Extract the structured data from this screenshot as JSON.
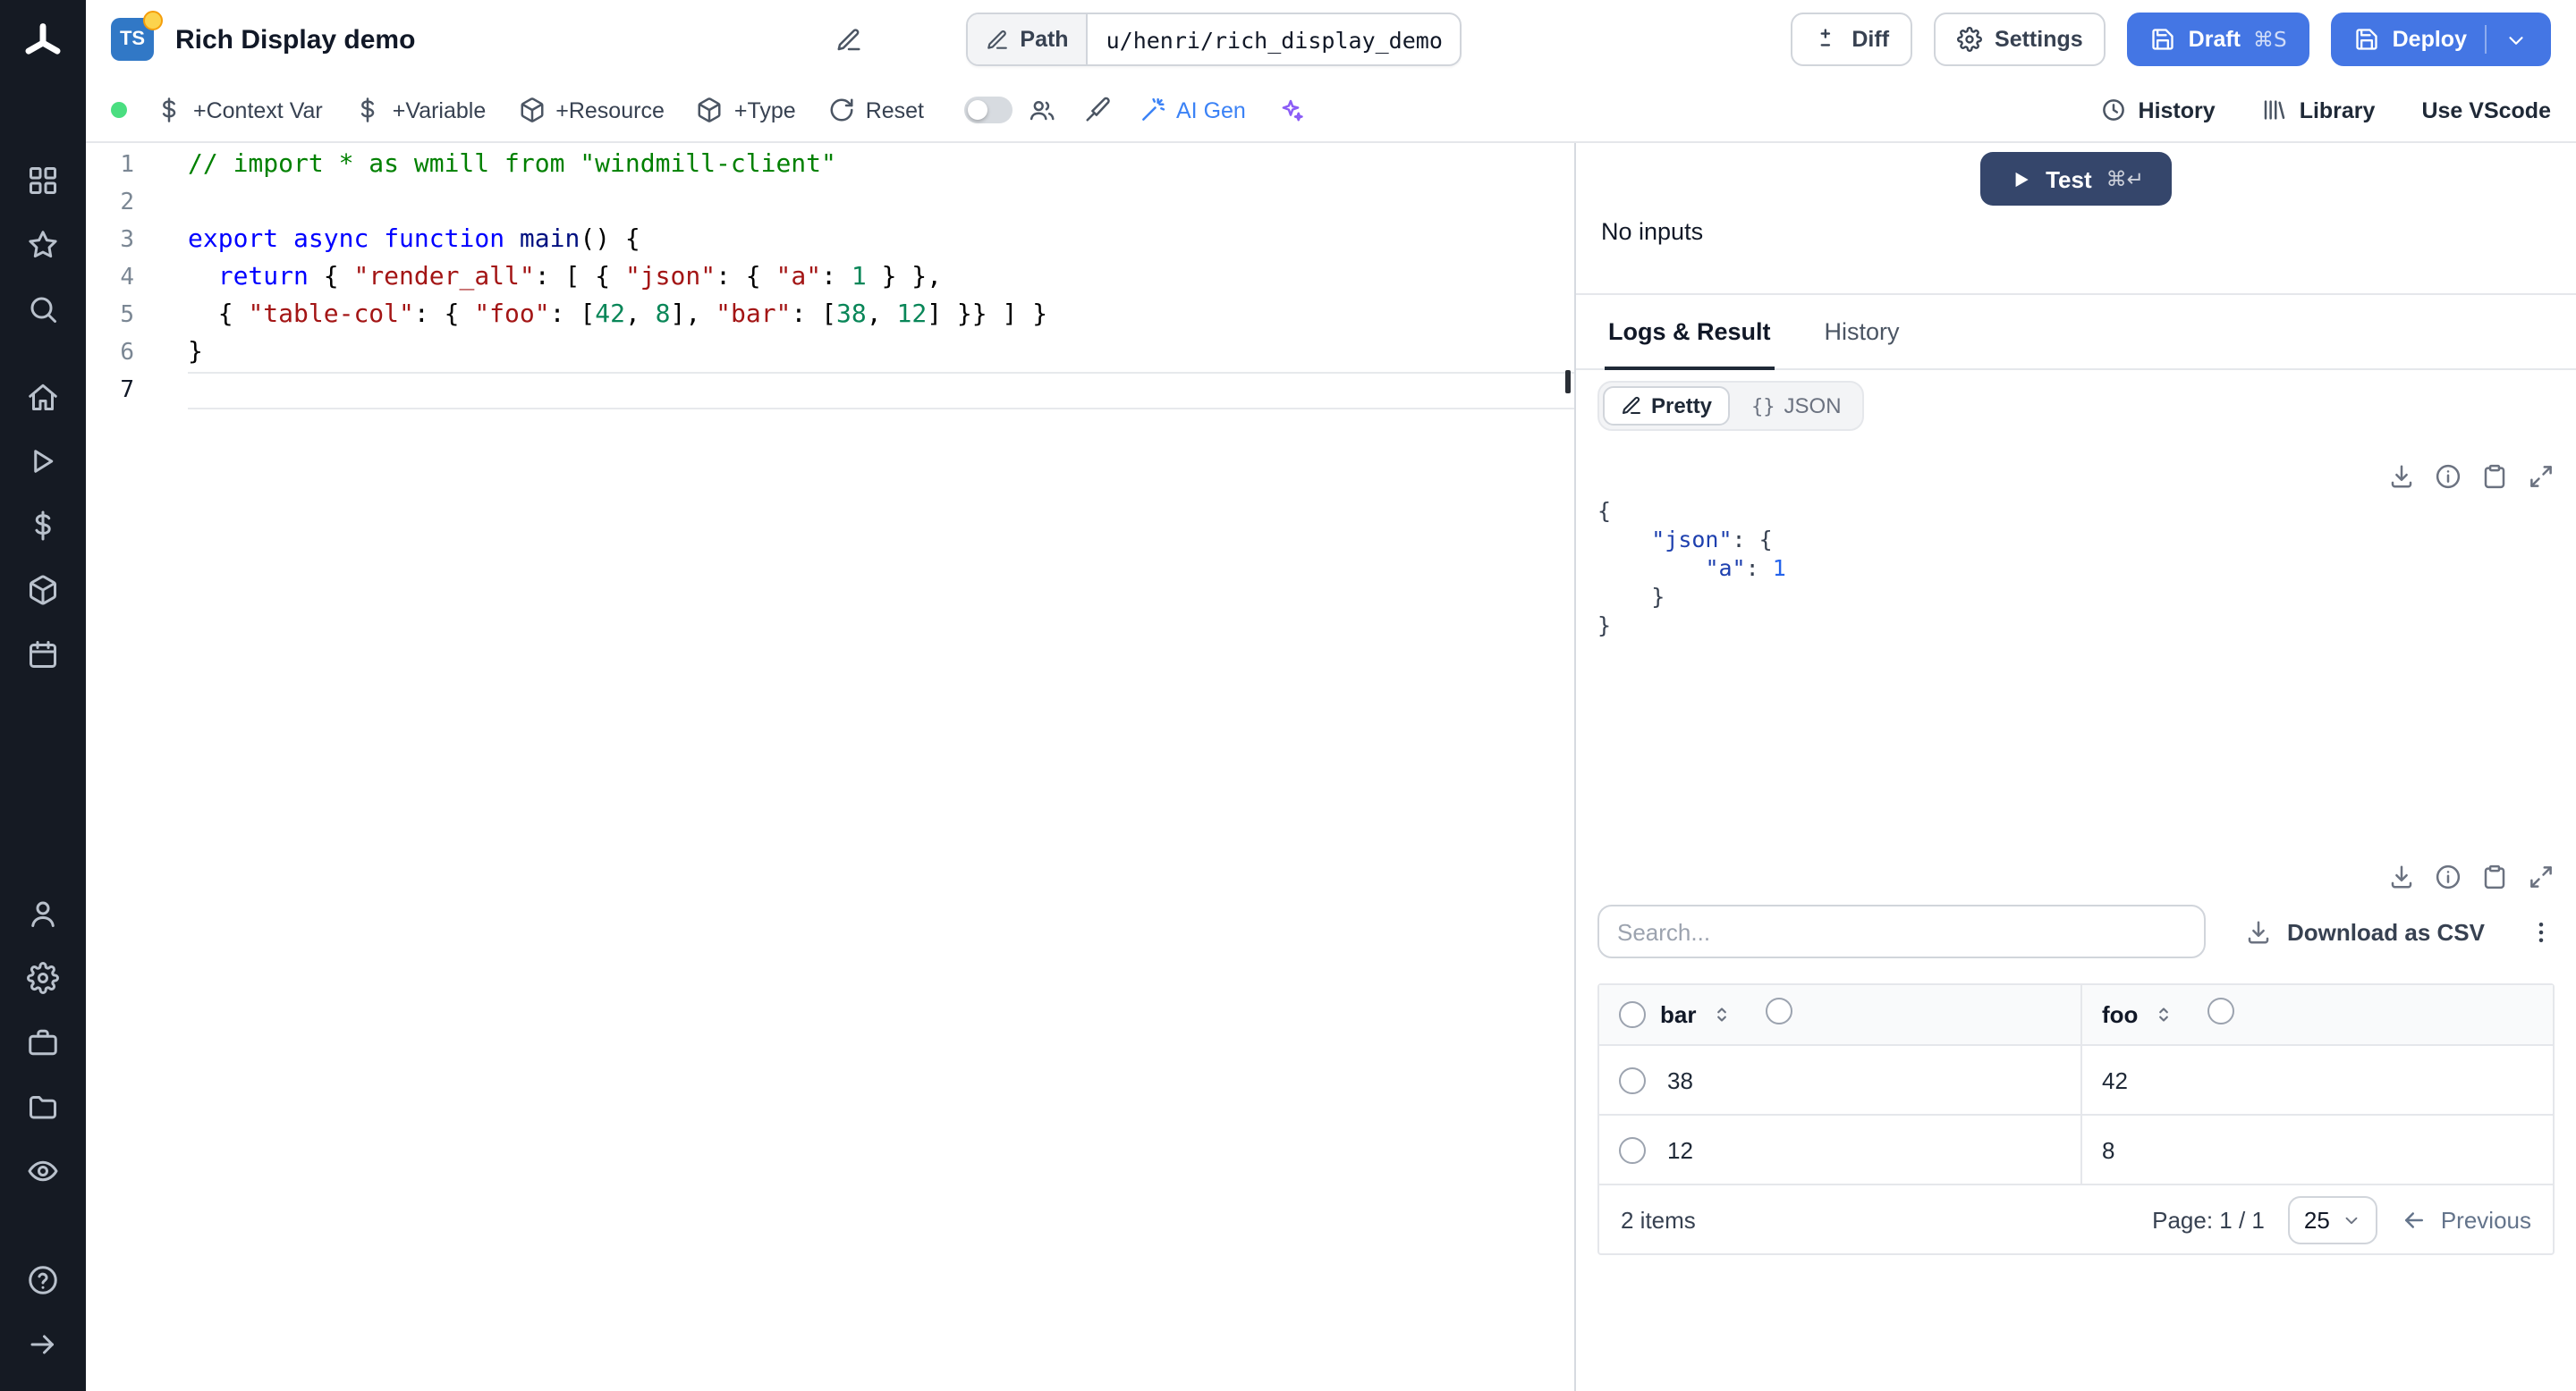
{
  "colors": {
    "primary_blue": "#4476e4",
    "test_dark": "#35466b",
    "ai_blue": "#3b82f6",
    "status_green": "#4ade80"
  },
  "sidebar": {
    "groups": [
      [
        "grid",
        "star",
        "search"
      ],
      [
        "home",
        "play",
        "dollar",
        "package",
        "calendar"
      ],
      [
        "user",
        "settings",
        "briefcase",
        "folder",
        "eye"
      ]
    ],
    "bottom": [
      "help",
      "arrow-right"
    ]
  },
  "header": {
    "language_badge": "TS",
    "title": "Rich Display demo",
    "path_label": "Path",
    "path_value": "u/henri/rich_display_demo",
    "diff_label": "Diff",
    "settings_label": "Settings",
    "draft_label": "Draft",
    "draft_shortcut": "⌘S",
    "deploy_label": "Deploy"
  },
  "toolbar": {
    "items": [
      {
        "icon": "dollar",
        "label": "+Context Var"
      },
      {
        "icon": "dollar",
        "label": "+Variable"
      },
      {
        "icon": "package",
        "label": "+Resource"
      },
      {
        "icon": "package",
        "label": "+Type"
      },
      {
        "icon": "refresh",
        "label": "Reset"
      }
    ],
    "ai_gen_label": "AI Gen",
    "history_label": "History",
    "library_label": "Library",
    "vscode_label": "Use VScode"
  },
  "editor": {
    "lines": [
      {
        "n": 1,
        "tokens": [
          [
            "// import * as wmill from \"windmill-client\"",
            "comment"
          ]
        ]
      },
      {
        "n": 2,
        "tokens": []
      },
      {
        "n": 3,
        "tokens": [
          [
            "export ",
            "kw"
          ],
          [
            "async ",
            "kw"
          ],
          [
            "function ",
            "kw"
          ],
          [
            "main",
            "ident"
          ],
          [
            "() {",
            "plain"
          ]
        ]
      },
      {
        "n": 4,
        "tokens": [
          [
            "  ",
            "plain"
          ],
          [
            "return",
            "kw"
          ],
          [
            " { ",
            "plain"
          ],
          [
            "\"render_all\"",
            "str"
          ],
          [
            ": [ { ",
            "plain"
          ],
          [
            "\"json\"",
            "str"
          ],
          [
            ": { ",
            "plain"
          ],
          [
            "\"a\"",
            "str"
          ],
          [
            ": ",
            "plain"
          ],
          [
            "1",
            "num"
          ],
          [
            " } },",
            "plain"
          ]
        ]
      },
      {
        "n": 5,
        "tokens": [
          [
            "  { ",
            "plain"
          ],
          [
            "\"table-col\"",
            "str"
          ],
          [
            ": { ",
            "plain"
          ],
          [
            "\"foo\"",
            "str"
          ],
          [
            ": [",
            "plain"
          ],
          [
            "42",
            "num"
          ],
          [
            ", ",
            "plain"
          ],
          [
            "8",
            "num"
          ],
          [
            "], ",
            "plain"
          ],
          [
            "\"bar\"",
            "str"
          ],
          [
            ": [",
            "plain"
          ],
          [
            "38",
            "num"
          ],
          [
            ", ",
            "plain"
          ],
          [
            "12",
            "num"
          ],
          [
            "] }} ] }",
            "plain"
          ]
        ]
      },
      {
        "n": 6,
        "tokens": [
          [
            "}",
            "plain"
          ]
        ]
      },
      {
        "n": 7,
        "tokens": [],
        "current": true
      }
    ]
  },
  "run": {
    "test_label": "Test",
    "test_shortcut": "⌘↵",
    "no_inputs": "No inputs"
  },
  "tabs": {
    "logs_result": "Logs & Result",
    "history": "History"
  },
  "result": {
    "pretty_label": "Pretty",
    "json_label": "JSON",
    "json_lines": [
      [
        [
          "{",
          "plain"
        ]
      ],
      [
        [
          "    ",
          "plain"
        ],
        [
          "\"json\"",
          "key"
        ],
        [
          ": {",
          "plain"
        ]
      ],
      [
        [
          "        ",
          "plain"
        ],
        [
          "\"a\"",
          "key"
        ],
        [
          ": ",
          "plain"
        ],
        [
          "1",
          "num"
        ]
      ],
      [
        [
          "    }",
          "plain"
        ]
      ],
      [
        [
          "}",
          "plain"
        ]
      ]
    ]
  },
  "table": {
    "search_placeholder": "Search...",
    "download_csv": "Download as CSV",
    "columns": [
      "bar",
      "foo"
    ],
    "rows": [
      [
        "38",
        "42"
      ],
      [
        "12",
        "8"
      ]
    ],
    "items_count": "2 items",
    "page_label": "Page: 1 / 1",
    "page_size": "25",
    "previous": "Previous"
  }
}
